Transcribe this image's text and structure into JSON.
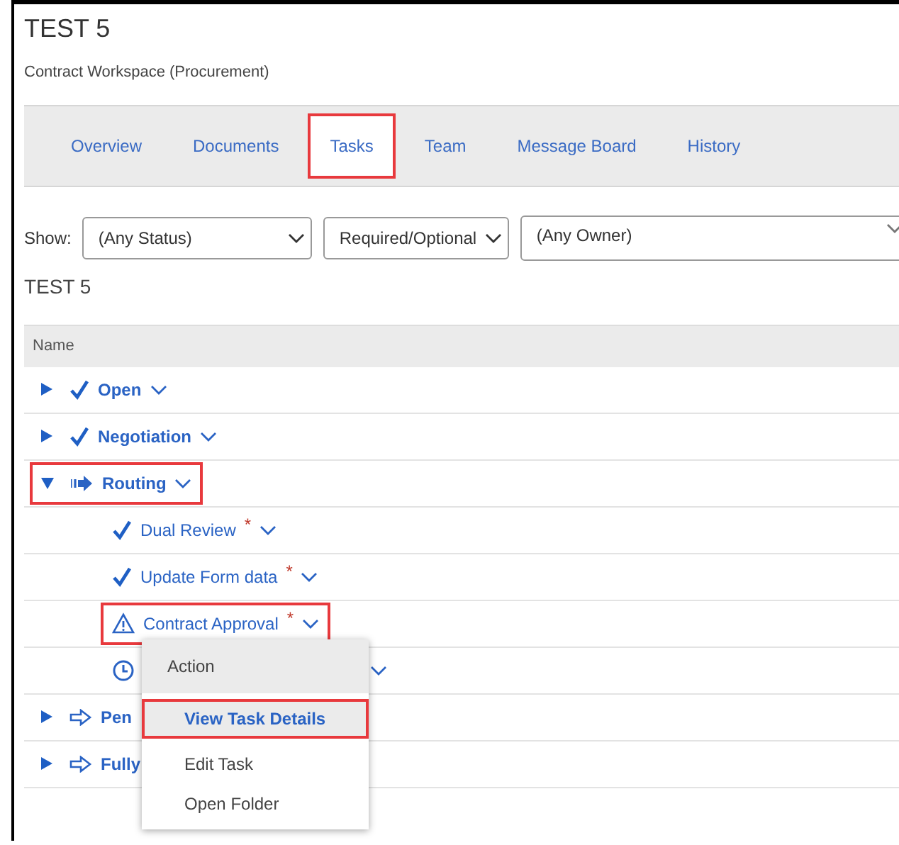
{
  "title": "TEST 5",
  "subtitle": "Contract Workspace (Procurement)",
  "tabs": [
    {
      "label": "Overview",
      "selected": false,
      "highlighted": false
    },
    {
      "label": "Documents",
      "selected": false,
      "highlighted": false
    },
    {
      "label": "Tasks",
      "selected": true,
      "highlighted": true
    },
    {
      "label": "Team",
      "selected": false,
      "highlighted": false
    },
    {
      "label": "Message Board",
      "selected": false,
      "highlighted": false
    },
    {
      "label": "History",
      "selected": false,
      "highlighted": false
    }
  ],
  "filters": {
    "label": "Show:",
    "selects": [
      {
        "value": "(Any Status)"
      },
      {
        "value": "Required/Optional"
      },
      {
        "value": "(Any Owner)"
      }
    ]
  },
  "section_title": "TEST 5",
  "table": {
    "columns": [
      "Name"
    ],
    "rows": [
      {
        "name": "Open",
        "kind": "check",
        "expanded": false,
        "highlighted": false,
        "chevron_visible": true
      },
      {
        "name": "Negotiation",
        "kind": "check",
        "expanded": false,
        "highlighted": false,
        "chevron_visible": true
      },
      {
        "name": "Routing",
        "kind": "routing",
        "expanded": true,
        "highlighted": true,
        "chevron_visible": true,
        "children": [
          {
            "name": "Dual Review",
            "kind": "check",
            "required_mark": "*",
            "highlighted": false,
            "chevron_visible": true
          },
          {
            "name": "Update Form data",
            "kind": "check",
            "required_mark": "*",
            "highlighted": false,
            "chevron_visible": true
          },
          {
            "name": "Contract Approval",
            "kind": "warning",
            "required_mark": "*",
            "highlighted": true,
            "chevron_visible": true,
            "menu_open": true
          },
          {
            "kind": "clock",
            "highlighted": false,
            "chevron_visible": true
          }
        ]
      },
      {
        "name": "Pen",
        "kind": "arrow",
        "expanded": false,
        "highlighted": false,
        "chevron_visible": false
      },
      {
        "name": "Fully",
        "kind": "arrow",
        "expanded": false,
        "highlighted": false,
        "chevron_visible": false
      }
    ]
  },
  "menu": {
    "header": "Action",
    "items": [
      {
        "label": "View Task Details",
        "selected": true,
        "highlighted": true
      },
      {
        "label": "Edit Task",
        "selected": false,
        "highlighted": false
      },
      {
        "label": "Open Folder",
        "selected": false,
        "highlighted": false
      }
    ]
  }
}
